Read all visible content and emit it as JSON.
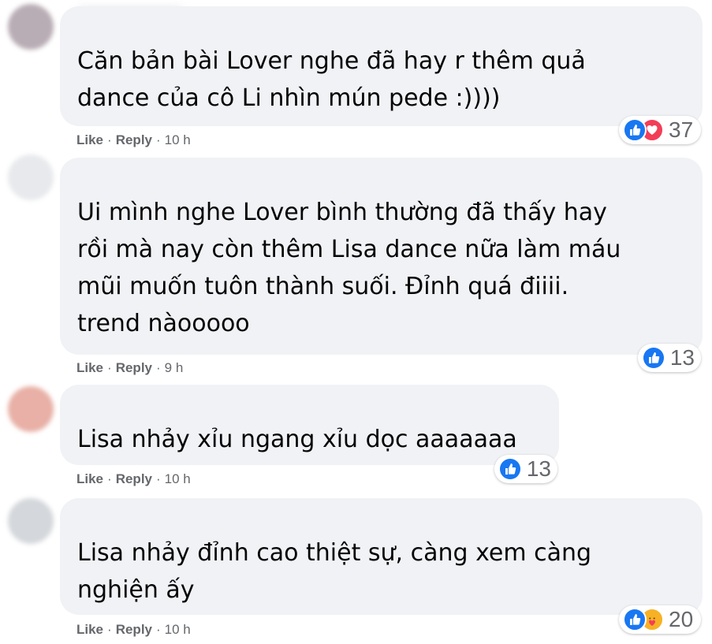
{
  "comments": [
    {
      "text": "Căn bản bài Lover nghe đã hay r thêm quả\ndance của cô Li nhìn mún pede :))))",
      "like_label": "Like",
      "reply_label": "Reply",
      "time": "10 h",
      "reaction_count": "37",
      "reactions": [
        "like-icon",
        "love-icon"
      ]
    },
    {
      "text": "Ui mình nghe Lover bình thường đã thấy hay\nrồi mà nay còn thêm Lisa dance nữa làm máu\nmũi muốn tuôn thành suối. Đỉnh quá điiii.\ntrend nàooooo",
      "like_label": "Like",
      "reply_label": "Reply",
      "time": "9 h",
      "reaction_count": "13",
      "reactions": [
        "like-icon"
      ]
    },
    {
      "text": "Lisa nhảy xỉu ngang xỉu dọc aaaaaaa",
      "like_label": "Like",
      "reply_label": "Reply",
      "time": "10 h",
      "reaction_count": "13",
      "reactions": [
        "like-icon"
      ]
    },
    {
      "text": "Lisa nhảy đỉnh cao thiệt sự, càng xem càng\nnghiện ấy",
      "like_label": "Like",
      "reply_label": "Reply",
      "time": "10 h",
      "reaction_count": "20",
      "reactions": [
        "like-icon",
        "care-icon"
      ]
    }
  ],
  "colors": {
    "bubble": "#f0f2f5",
    "like": "#1877f2",
    "love": "#f33e58",
    "care": "#f7b125",
    "meta": "#65676b"
  }
}
